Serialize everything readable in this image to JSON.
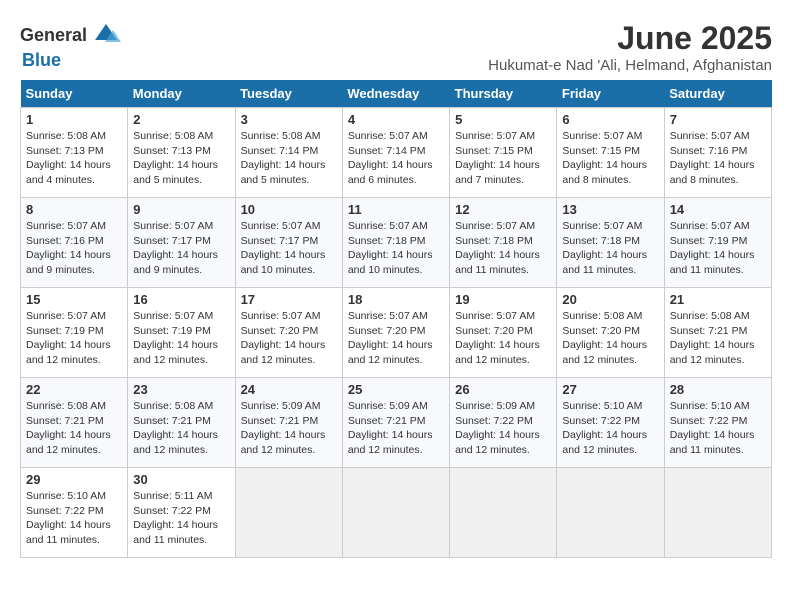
{
  "header": {
    "logo_general": "General",
    "logo_blue": "Blue",
    "title": "June 2025",
    "subtitle": "Hukumat-e Nad 'Ali, Helmand, Afghanistan"
  },
  "calendar": {
    "days_of_week": [
      "Sunday",
      "Monday",
      "Tuesday",
      "Wednesday",
      "Thursday",
      "Friday",
      "Saturday"
    ],
    "weeks": [
      [
        null,
        null,
        null,
        null,
        null,
        null,
        null
      ]
    ],
    "cells": [
      {
        "day": null,
        "empty": true
      },
      {
        "day": null,
        "empty": true
      },
      {
        "day": null,
        "empty": true
      },
      {
        "day": null,
        "empty": true
      },
      {
        "day": null,
        "empty": true
      },
      {
        "day": null,
        "empty": true
      },
      {
        "day": null,
        "empty": true
      }
    ]
  },
  "days": {
    "w1": [
      {
        "num": "1",
        "rise": "5:08 AM",
        "set": "7:13 PM",
        "daylight": "14 hours and 4 minutes."
      },
      {
        "num": "2",
        "rise": "5:08 AM",
        "set": "7:13 PM",
        "daylight": "14 hours and 5 minutes."
      },
      {
        "num": "3",
        "rise": "5:08 AM",
        "set": "7:14 PM",
        "daylight": "14 hours and 5 minutes."
      },
      {
        "num": "4",
        "rise": "5:07 AM",
        "set": "7:14 PM",
        "daylight": "14 hours and 6 minutes."
      },
      {
        "num": "5",
        "rise": "5:07 AM",
        "set": "7:15 PM",
        "daylight": "14 hours and 7 minutes."
      },
      {
        "num": "6",
        "rise": "5:07 AM",
        "set": "7:15 PM",
        "daylight": "14 hours and 8 minutes."
      },
      {
        "num": "7",
        "rise": "5:07 AM",
        "set": "7:16 PM",
        "daylight": "14 hours and 8 minutes."
      }
    ],
    "w2": [
      {
        "num": "8",
        "rise": "5:07 AM",
        "set": "7:16 PM",
        "daylight": "14 hours and 9 minutes."
      },
      {
        "num": "9",
        "rise": "5:07 AM",
        "set": "7:17 PM",
        "daylight": "14 hours and 9 minutes."
      },
      {
        "num": "10",
        "rise": "5:07 AM",
        "set": "7:17 PM",
        "daylight": "14 hours and 10 minutes."
      },
      {
        "num": "11",
        "rise": "5:07 AM",
        "set": "7:18 PM",
        "daylight": "14 hours and 10 minutes."
      },
      {
        "num": "12",
        "rise": "5:07 AM",
        "set": "7:18 PM",
        "daylight": "14 hours and 11 minutes."
      },
      {
        "num": "13",
        "rise": "5:07 AM",
        "set": "7:18 PM",
        "daylight": "14 hours and 11 minutes."
      },
      {
        "num": "14",
        "rise": "5:07 AM",
        "set": "7:19 PM",
        "daylight": "14 hours and 11 minutes."
      }
    ],
    "w3": [
      {
        "num": "15",
        "rise": "5:07 AM",
        "set": "7:19 PM",
        "daylight": "14 hours and 12 minutes."
      },
      {
        "num": "16",
        "rise": "5:07 AM",
        "set": "7:19 PM",
        "daylight": "14 hours and 12 minutes."
      },
      {
        "num": "17",
        "rise": "5:07 AM",
        "set": "7:20 PM",
        "daylight": "14 hours and 12 minutes."
      },
      {
        "num": "18",
        "rise": "5:07 AM",
        "set": "7:20 PM",
        "daylight": "14 hours and 12 minutes."
      },
      {
        "num": "19",
        "rise": "5:07 AM",
        "set": "7:20 PM",
        "daylight": "14 hours and 12 minutes."
      },
      {
        "num": "20",
        "rise": "5:08 AM",
        "set": "7:20 PM",
        "daylight": "14 hours and 12 minutes."
      },
      {
        "num": "21",
        "rise": "5:08 AM",
        "set": "7:21 PM",
        "daylight": "14 hours and 12 minutes."
      }
    ],
    "w4": [
      {
        "num": "22",
        "rise": "5:08 AM",
        "set": "7:21 PM",
        "daylight": "14 hours and 12 minutes."
      },
      {
        "num": "23",
        "rise": "5:08 AM",
        "set": "7:21 PM",
        "daylight": "14 hours and 12 minutes."
      },
      {
        "num": "24",
        "rise": "5:09 AM",
        "set": "7:21 PM",
        "daylight": "14 hours and 12 minutes."
      },
      {
        "num": "25",
        "rise": "5:09 AM",
        "set": "7:21 PM",
        "daylight": "14 hours and 12 minutes."
      },
      {
        "num": "26",
        "rise": "5:09 AM",
        "set": "7:22 PM",
        "daylight": "14 hours and 12 minutes."
      },
      {
        "num": "27",
        "rise": "5:10 AM",
        "set": "7:22 PM",
        "daylight": "14 hours and 12 minutes."
      },
      {
        "num": "28",
        "rise": "5:10 AM",
        "set": "7:22 PM",
        "daylight": "14 hours and 11 minutes."
      }
    ],
    "w5": [
      {
        "num": "29",
        "rise": "5:10 AM",
        "set": "7:22 PM",
        "daylight": "14 hours and 11 minutes."
      },
      {
        "num": "30",
        "rise": "5:11 AM",
        "set": "7:22 PM",
        "daylight": "14 hours and 11 minutes."
      },
      null,
      null,
      null,
      null,
      null
    ]
  },
  "labels": {
    "sunrise": "Sunrise:",
    "sunset": "Sunset:",
    "daylight": "Daylight:"
  }
}
